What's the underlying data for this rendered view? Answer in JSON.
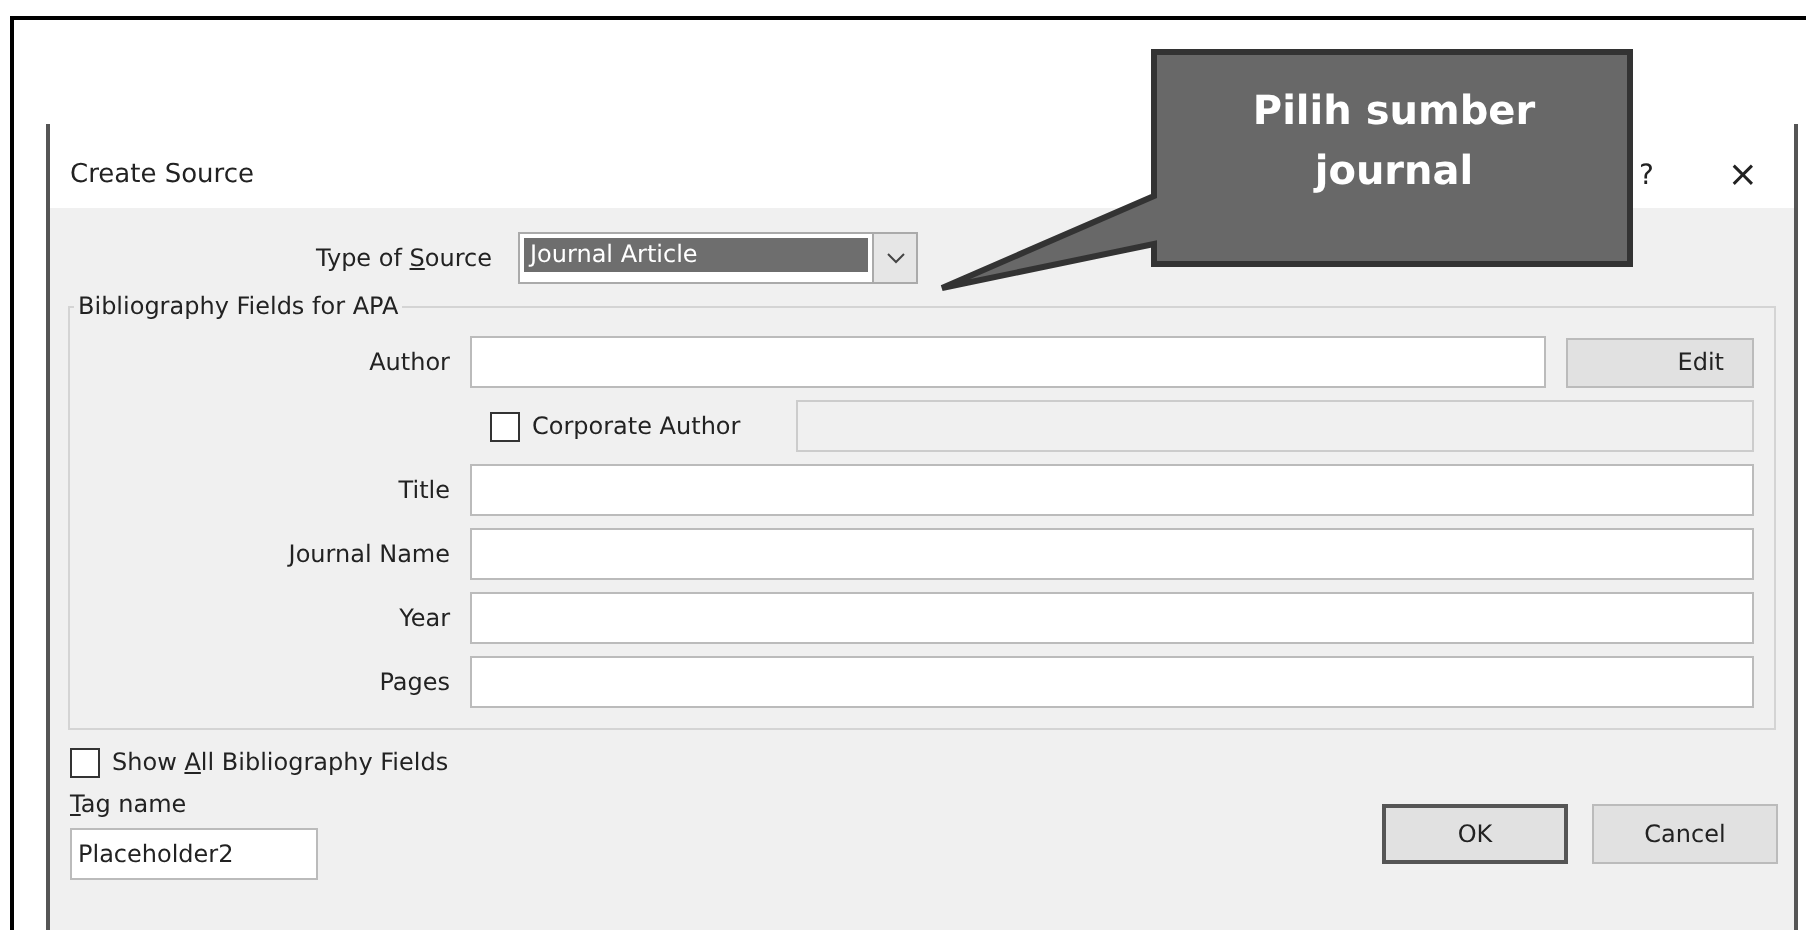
{
  "callout": {
    "text": "Pilih sumber journal"
  },
  "window": {
    "title": "Create Source",
    "help": "?",
    "close": "×"
  },
  "type_of_source": {
    "label": {
      "before": "Type of ",
      "key": "S",
      "after": "ource"
    },
    "value": "Journal Article",
    "selected": true
  },
  "group": {
    "title": "Bibliography Fields for APA",
    "rows": [
      {
        "kind": "field_button",
        "label": "Author",
        "button": "Edit"
      },
      {
        "kind": "checkbox_field",
        "label": "Corporate Author",
        "checked": false,
        "disabled": true
      },
      {
        "kind": "field",
        "label": "Title"
      },
      {
        "kind": "field",
        "label": "Journal Name"
      },
      {
        "kind": "field",
        "label": "Year"
      },
      {
        "kind": "field",
        "label": "Pages"
      }
    ]
  },
  "show_all": {
    "label": {
      "before": "Show ",
      "key": "A",
      "after": "ll Bibliography Fields"
    },
    "checked": false
  },
  "tag_name": {
    "label": {
      "key": "T",
      "after": "ag name"
    },
    "value": "Placeholder2"
  },
  "buttons": [
    {
      "label": "OK",
      "default": true
    },
    {
      "label": "Cancel",
      "default": false
    }
  ]
}
